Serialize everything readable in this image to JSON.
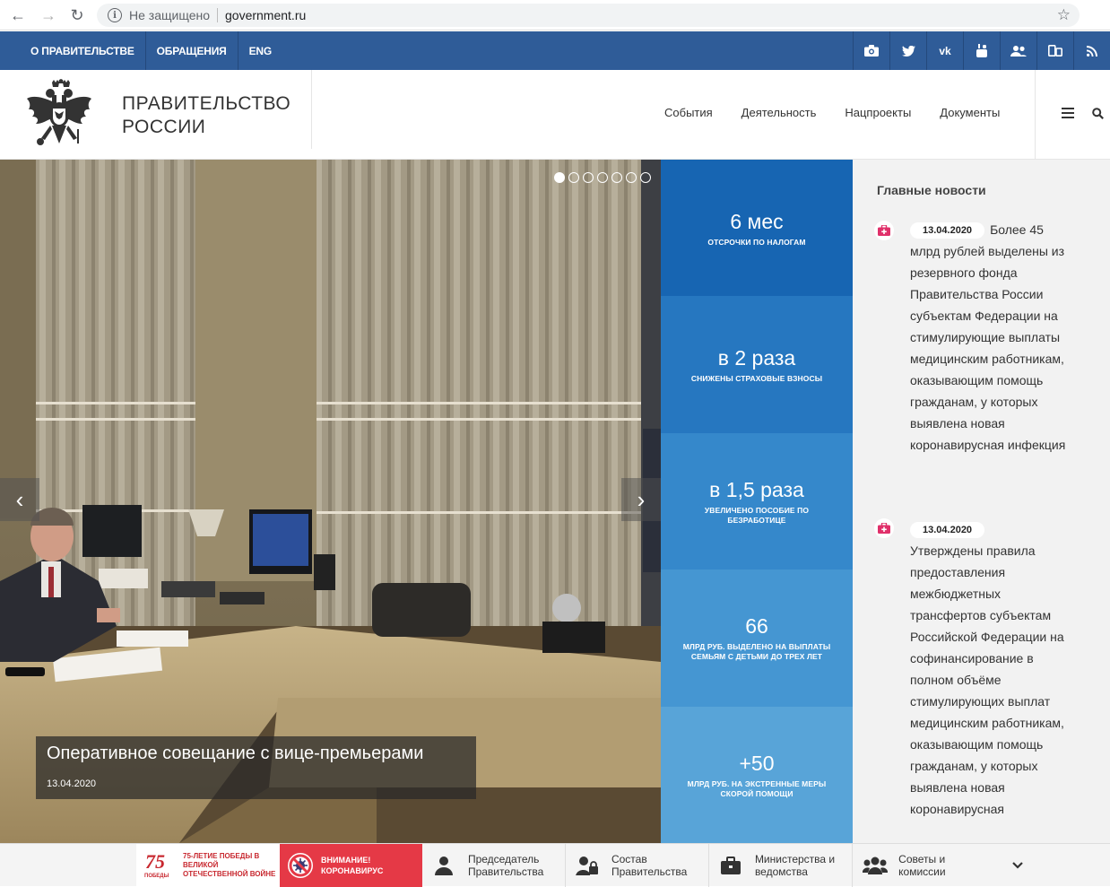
{
  "browser": {
    "back": "←",
    "forward": "→",
    "reload": "↻",
    "info": "i",
    "security": "Не защищено",
    "url": "government.ru",
    "star": "☆"
  },
  "topnav": {
    "links": [
      "О ПРАВИТЕЛЬСТВЕ",
      "ОБРАЩЕНИЯ",
      "ENG"
    ],
    "social_icons": [
      "camera-icon",
      "twitter-icon",
      "vk-icon",
      "youtube-icon",
      "community-icon",
      "devices-icon",
      "rss-icon"
    ],
    "social_glyphs": [
      "◙",
      "✦",
      "vk",
      "▶",
      "👥",
      "▯▫",
      "◠"
    ]
  },
  "header": {
    "title_line1": "ПРАВИТЕЛЬСТВО",
    "title_line2": "РОССИИ",
    "nav": [
      "События",
      "Деятельность",
      "Нацпроекты",
      "Документы"
    ]
  },
  "hero": {
    "caption_title": "Оперативное совещание с вице-премьерами",
    "caption_date": "13.04.2020",
    "slides_total": 7,
    "active_slide": 1,
    "prev_arrow": "‹",
    "next_arrow": "›"
  },
  "stats": [
    {
      "big": "6 мес",
      "small": "ОТСРОЧКИ ПО НАЛОГАМ",
      "color": "#1765b2"
    },
    {
      "big": "в 2 раза",
      "small": "СНИЖЕНЫ СТРАХОВЫЕ ВЗНОСЫ",
      "color": "#2677c0"
    },
    {
      "big": "в 1,5 раза",
      "small": "УВЕЛИЧЕНО ПОСОБИЕ ПО БЕЗРАБОТИЦЕ",
      "color": "#3588cb"
    },
    {
      "big": "66",
      "small": "МЛРД РУБ. ВЫДЕЛЕНО НА ВЫПЛАТЫ СЕМЬЯМ С ДЕТЬМИ ДО ТРЕХ ЛЕТ",
      "color": "#4596d2"
    },
    {
      "big": "+50",
      "small": "МЛРД РУБ. НА ЭКСТРЕННЫЕ МЕРЫ СКОРОЙ ПОМОЩИ",
      "color": "#58a4d8"
    }
  ],
  "news": {
    "heading": "Главные новости",
    "items": [
      {
        "date": "13.04.2020",
        "text": "Более 45 млрд рублей выделены из резервного фонда Правительства России субъектам Федерации на стимулирующие выплаты медицинским работникам, оказывающим помощь гражданам, у которых выявлена новая коронавирусная инфекция"
      },
      {
        "date": "13.04.2020",
        "text": "Утверждены правила предоставления межбюджетных трансфертов субъектам Российской Федерации на софинансирование в полном объёме стимулирующих выплат медицинским работникам, оказывающим помощь гражданам, у которых выявлена новая коронавирусная"
      }
    ]
  },
  "bottombar": {
    "victory_badge": "75",
    "victory_caption": "ПОБЕДЫ",
    "victory": "75-ЛЕТИЕ ПОБЕДЫ В ВЕЛИКОЙ ОТЕЧЕСТВЕННОЙ ВОЙНЕ",
    "covid_line1": "ВНИМАНИЕ!",
    "covid_line2": "КОРОНАВИРУС",
    "links": [
      {
        "line1": "Председатель",
        "line2": "Правительства",
        "icon": "person-icon"
      },
      {
        "line1": "Состав",
        "line2": "Правительства",
        "icon": "people-lock-icon"
      },
      {
        "line1": "Министерства и",
        "line2": "ведомства",
        "icon": "briefcase-icon"
      },
      {
        "line1": "Советы и",
        "line2": "комиссии",
        "icon": "group-icon"
      }
    ],
    "more": "⌄"
  }
}
